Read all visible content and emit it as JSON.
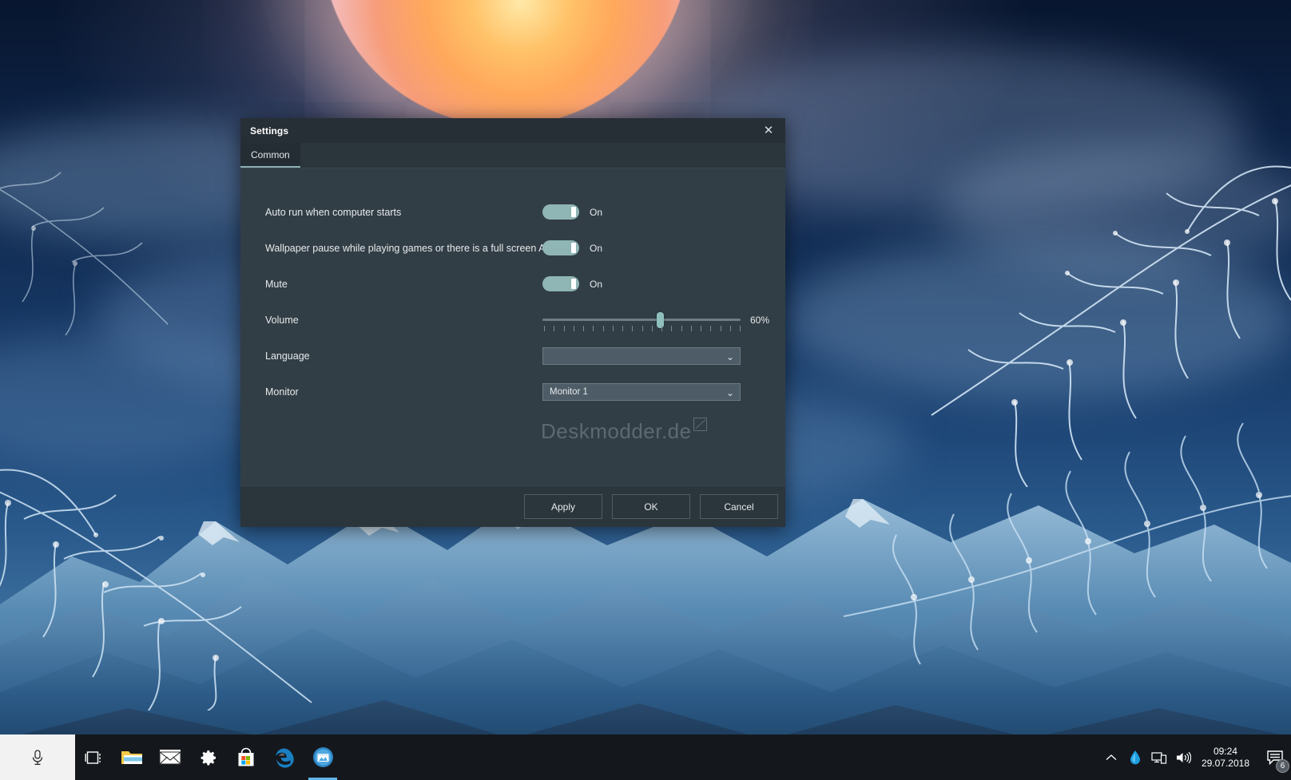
{
  "desktop": {
    "wallpaper_description": "Fantasy night sky with large orange moon, clouds, snowy mountains and frosted pine branches",
    "colors": {
      "sky_top": "#08162f",
      "sky_bottom": "#4a7ca8",
      "moon_core": "#ffc268",
      "mountain": "#1d4a72"
    }
  },
  "taskbar": {
    "background": "#14181d",
    "cortana": {
      "name": "cortana-search",
      "icon": "microphone-icon",
      "background": "#f2f2f2"
    },
    "items": [
      {
        "name": "task-view",
        "icon": "task-view-icon",
        "label": "Task View",
        "active": false
      },
      {
        "name": "file-explorer",
        "icon": "folder-icon",
        "label": "File Explorer",
        "active": false
      },
      {
        "name": "mail",
        "icon": "mail-icon",
        "label": "Mail",
        "active": false
      },
      {
        "name": "settings",
        "icon": "gear-icon",
        "label": "Settings",
        "active": false
      },
      {
        "name": "microsoft-store",
        "icon": "store-bag-icon",
        "label": "Microsoft Store",
        "active": false
      },
      {
        "name": "microsoft-edge",
        "icon": "edge-icon",
        "label": "Microsoft Edge",
        "active": false
      },
      {
        "name": "wallpaper-engine",
        "icon": "wallpaper-app-icon",
        "label": "Wallpaper App",
        "active": true
      }
    ],
    "tray": {
      "show_hidden": {
        "name": "show-hidden-icons",
        "icon": "chevron-up-icon"
      },
      "icons": [
        {
          "name": "tray-droplet",
          "icon": "water-droplet-icon",
          "color": "#1e9de0"
        },
        {
          "name": "tray-network",
          "icon": "network-monitor-icon"
        },
        {
          "name": "tray-volume",
          "icon": "speaker-icon"
        }
      ],
      "clock": {
        "time": "09:24",
        "date": "29.07.2018"
      },
      "notifications": {
        "name": "action-center",
        "icon": "speech-bubble-icon",
        "badge": "6"
      }
    }
  },
  "dialog": {
    "title": "Settings",
    "close_label": "✕",
    "tabs": [
      {
        "label": "Common",
        "selected": true
      }
    ],
    "watermark": "Deskmodder.de",
    "rows": [
      {
        "label": "Auto run when computer starts",
        "control": "toggle",
        "state": "On",
        "value": true
      },
      {
        "label": "Wallpaper pause while playing games or there is a full screen App",
        "control": "toggle",
        "state": "On",
        "value": true
      },
      {
        "label": "Mute",
        "control": "toggle",
        "state": "On",
        "value": true
      },
      {
        "label": "Volume",
        "control": "slider",
        "value": 60,
        "display": "60%",
        "min": 0,
        "max": 100
      },
      {
        "label": "Language",
        "control": "dropdown",
        "selected": "",
        "arrow": "⌄"
      },
      {
        "label": "Monitor",
        "control": "dropdown",
        "selected": "Monitor 1",
        "arrow": "⌄"
      }
    ],
    "buttons": [
      {
        "label": "Apply",
        "name": "apply-button"
      },
      {
        "label": "OK",
        "name": "ok-button"
      },
      {
        "label": "Cancel",
        "name": "cancel-button"
      }
    ],
    "colors": {
      "titlebar": "#272f36",
      "body": "#323e46",
      "footer": "#2b353c",
      "toggle_on": "#8fb5b4",
      "slider_thumb": "#8fc0bd",
      "text": "#e6eaec"
    }
  }
}
